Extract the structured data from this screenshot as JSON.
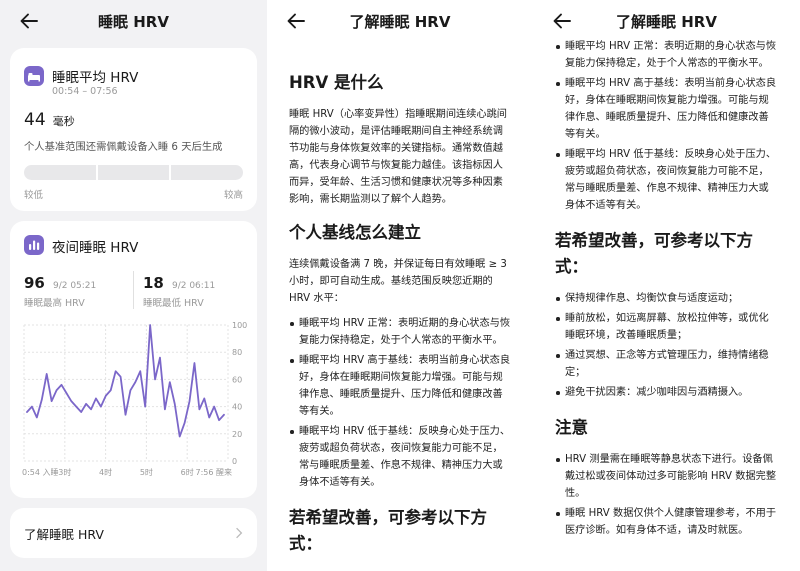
{
  "p1": {
    "title": "睡眠 HRV",
    "avg_card": {
      "title": "睡眠平均 HRV",
      "time_range": "00:54 – 07:56",
      "value": "44",
      "unit": "毫秒",
      "note": "个人基准范围还需佩戴设备入睡 6 天后生成",
      "range_low": "较低",
      "range_high": "较高"
    },
    "night_card": {
      "title": "夜间睡眠 HRV",
      "max_value": "96",
      "max_time": "9/2 05:21",
      "max_label": "睡眠最高 HRV",
      "min_value": "18",
      "min_time": "9/2 06:11",
      "min_label": "睡眠最低 HRV"
    },
    "learn_more": "了解睡眠 HRV"
  },
  "chart_data": {
    "type": "line",
    "y_ticks": [
      "100",
      "80",
      "60",
      "40",
      "20",
      "0"
    ],
    "x_labels": [
      "0:54 入睡",
      "3时",
      "4时",
      "5时",
      "6时",
      "7:56 醒来"
    ],
    "ylim": [
      0,
      100
    ],
    "grid": true,
    "color": "#7b67c9",
    "values": [
      36,
      40,
      32,
      45,
      64,
      44,
      52,
      56,
      50,
      44,
      40,
      36,
      42,
      38,
      46,
      40,
      48,
      52,
      66,
      62,
      34,
      52,
      58,
      66,
      40,
      100,
      60,
      76,
      38,
      58,
      42,
      18,
      28,
      44,
      72,
      38,
      46,
      32,
      40,
      30,
      34
    ]
  },
  "p2": {
    "title": "了解睡眠 HRV",
    "h1": "HRV 是什么",
    "p1": "睡眠 HRV（心率变异性）指睡眠期间连续心跳间隔的微小波动，是评估睡眠期间自主神经系统调节功能与身体恢复效率的关键指标。通常数值越高，代表身心调节与恢复能力越佳。该指标因人而异，受年龄、生活习惯和健康状况等多种因素影响，需长期监测以了解个人趋势。",
    "h2": "个人基线怎么建立",
    "p2": "连续佩戴设备满 7 晚，并保证每日有效睡眠 ≥ 3 小时，即可自动生成。基线范围反映您近期的 HRV 水平：",
    "items": [
      "睡眠平均 HRV 正常：表明近期的身心状态与恢复能力保持稳定，处于个人常态的平衡水平。",
      "睡眠平均 HRV 高于基线：表明当前身心状态良好，身体在睡眠期间恢复能力增强。可能与规律作息、睡眠质量提升、压力降低和健康改善等有关。",
      "睡眠平均 HRV 低于基线：反映身心处于压力、疲劳或超负荷状态，夜间恢复能力可能不足，常与睡眠质量差、作息不规律、精神压力大或身体不适等有关。"
    ],
    "h3": "若希望改善，可参考以下方式："
  },
  "p3": {
    "title": "了解睡眠 HRV",
    "items_top": [
      "睡眠平均 HRV 正常：表明近期的身心状态与恢复能力保持稳定，处于个人常态的平衡水平。",
      "睡眠平均 HRV 高于基线：表明当前身心状态良好，身体在睡眠期间恢复能力增强。可能与规律作息、睡眠质量提升、压力降低和健康改善等有关。",
      "睡眠平均 HRV 低于基线：反映身心处于压力、疲劳或超负荷状态，夜间恢复能力可能不足，常与睡眠质量差、作息不规律、精神压力大或身体不适等有关。"
    ],
    "h_improve": "若希望改善，可参考以下方式：",
    "improve_items": [
      "保持规律作息、均衡饮食与适度运动；",
      "睡前放松，如远离屏幕、放松拉伸等，或优化睡眠环境，改善睡眠质量；",
      "通过冥想、正念等方式管理压力，维持情绪稳定；",
      "避免干扰因素：减少咖啡因与酒精摄入。"
    ],
    "h_note": "注意",
    "note_items": [
      "HRV 测量需在睡眠等静息状态下进行。设备佩戴过松或夜间体动过多可能影响 HRV 数据完整性。",
      "睡眠 HRV 数据仅供个人健康管理参考，不用于医疗诊断。如有身体不适，请及时就医。"
    ]
  }
}
